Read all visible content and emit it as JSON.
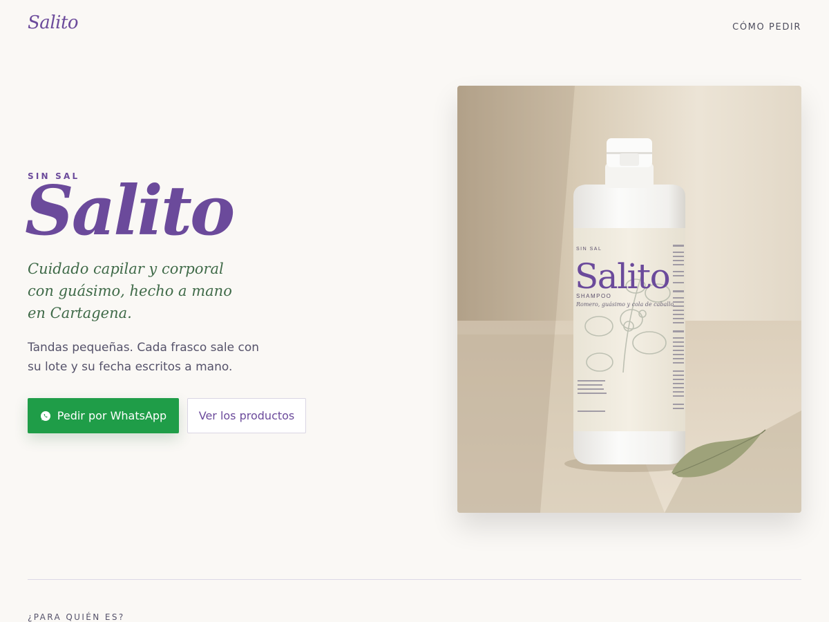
{
  "header": {
    "logo": "Salito",
    "nav_link": "CÓMO PEDIR"
  },
  "hero": {
    "eyebrow": "SIN SAL",
    "title": "Salito",
    "tagline": "Cuidado capilar y corporal con guásimo, hecho a mano en Cartagena.",
    "description": "Tandas pequeñas. Cada frasco sale con su lote y su fecha escritos a mano.",
    "primary_button": "Pedir por WhatsApp",
    "secondary_button": "Ver los productos"
  },
  "product_image": {
    "label_eyebrow": "SIN SAL",
    "label_brand": "Salito",
    "label_type": "SHAMPOO",
    "label_ingredients": "Romero, guásimo y cola de caballo."
  },
  "next_section": {
    "label": "¿PARA QUIÉN ES?"
  },
  "colors": {
    "brand_purple": "#6b4a9b",
    "whatsapp_green": "#1f9d48",
    "tagline_green": "#3f6a48",
    "background": "#faf8f5"
  },
  "icons": {
    "primary_button_icon": "whatsapp-icon"
  }
}
